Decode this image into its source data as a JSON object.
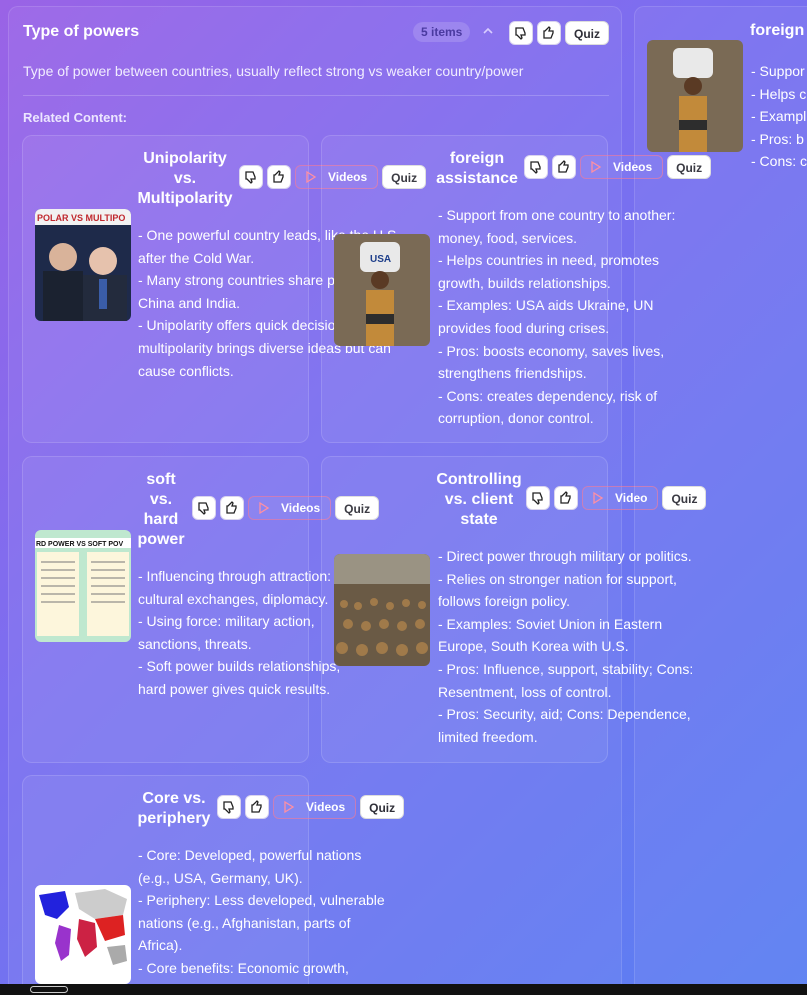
{
  "panel": {
    "title": "Type of powers",
    "item_count": "5 items",
    "description": "Type of power between countries, usually reflect strong vs weaker country/power",
    "related_label": "Related Content:",
    "quiz_label": "Quiz"
  },
  "cards": [
    {
      "title": [
        "Unipolarity",
        "vs.",
        "Multipolarity"
      ],
      "action_label": "Videos",
      "quiz_label": "Quiz",
      "lines": [
        "- One powerful country leads, like the U.S.",
        "after the Cold War.",
        "- Many strong countries share power, like",
        "China and India.",
        "- Unipolarity offers quick decisions;",
        "multipolarity brings diverse ideas but can",
        "cause conflicts."
      ],
      "image_text": "POLAR VS MULTIPO"
    },
    {
      "title": [
        "foreign",
        "assistance"
      ],
      "action_label": "Videos",
      "quiz_label": "Quiz",
      "lines": [
        "- Support from one country to another:",
        "money, food, services.",
        "- Helps countries in need, promotes",
        "growth, builds relationships.",
        "- Examples: USA aids Ukraine, UN",
        "provides food during crises.",
        "- Pros: boosts economy, saves lives,",
        "strengthens friendships.",
        "- Cons: creates dependency, risk of",
        "corruption, donor control."
      ],
      "image_text": "USA"
    },
    {
      "title": [
        "soft",
        "vs.",
        "hard",
        "power"
      ],
      "action_label": "Videos",
      "quiz_label": "Quiz",
      "lines": [
        "- Influencing through attraction:",
        "cultural exchanges, diplomacy.",
        "- Using force: military action,",
        "sanctions, threats.",
        "- Soft power builds relationships;",
        "hard power gives quick results."
      ],
      "image_text": "RD POWER VS SOFT POV"
    },
    {
      "title": [
        "Controlling",
        "vs. client",
        "state"
      ],
      "action_label": "Video",
      "quiz_label": "Quiz",
      "lines": [
        "- Direct power through military or politics.",
        "- Relies on stronger nation for support,",
        "follows foreign policy.",
        "- Examples: Soviet Union in Eastern",
        "Europe, South Korea with U.S.",
        "- Pros: Influence, support, stability; Cons:",
        "Resentment, loss of control.",
        "- Pros: Security, aid; Cons: Dependence,",
        "limited freedom."
      ]
    },
    {
      "title": [
        "Core vs.",
        "periphery"
      ],
      "action_label": "Videos",
      "quiz_label": "Quiz",
      "lines": [
        "- Core: Developed, powerful nations",
        "(e.g., USA, Germany, UK).",
        "- Periphery: Less developed, vulnerable",
        "nations (e.g., Afghanistan, parts of",
        "Africa).",
        "- Core benefits: Economic growth,"
      ]
    }
  ],
  "side": {
    "title": "foreign",
    "lines": [
      "- Suppor",
      "- Helps c",
      "- Exampl",
      "- Pros: b",
      "- Cons: c"
    ]
  }
}
